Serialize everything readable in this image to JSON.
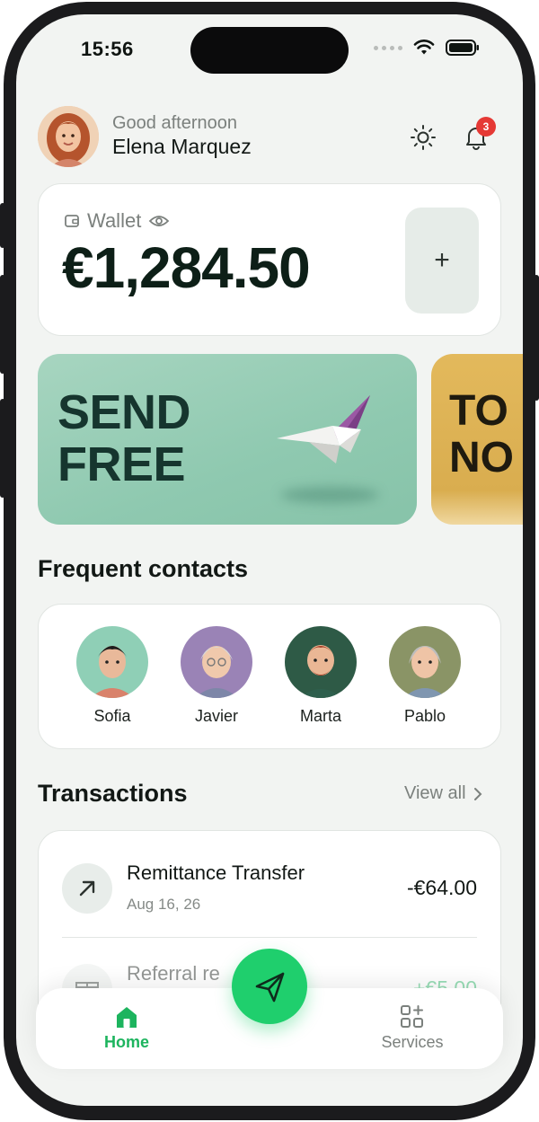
{
  "status_bar": {
    "time": "15:56"
  },
  "header": {
    "greeting": "Good afternoon",
    "user_name": "Elena Marquez",
    "notification_count": "3"
  },
  "wallet": {
    "label": "Wallet",
    "balance": "€1,284.50",
    "add_label": "+"
  },
  "promos": [
    {
      "line1": "SEND",
      "line2": "FREE",
      "color": "#9fd1ba"
    },
    {
      "line1": "TO",
      "line2": "NO",
      "color": "#e0b55a"
    }
  ],
  "frequent_contacts": {
    "title": "Frequent contacts",
    "items": [
      {
        "name": "Sofia",
        "bg": "#8fcfb6"
      },
      {
        "name": "Javier",
        "bg": "#9a83b6"
      },
      {
        "name": "Marta",
        "bg": "#2e5a46"
      },
      {
        "name": "Pablo",
        "bg": "#8a9466"
      }
    ]
  },
  "transactions": {
    "title": "Transactions",
    "view_all": "View all",
    "items": [
      {
        "title": "Remittance Transfer",
        "date": "Aug 16, 26",
        "amount": "-€64.00",
        "icon": "arrow-up-right-icon"
      },
      {
        "title": "Referral re",
        "date": "",
        "amount": "+€5.00",
        "icon": "gift-icon"
      }
    ]
  },
  "bottom_nav": {
    "home_label": "Home",
    "services_label": "Services"
  },
  "colors": {
    "accent": "#1fcf6d",
    "dark_green": "#0d1f17",
    "badge": "#e53935"
  }
}
